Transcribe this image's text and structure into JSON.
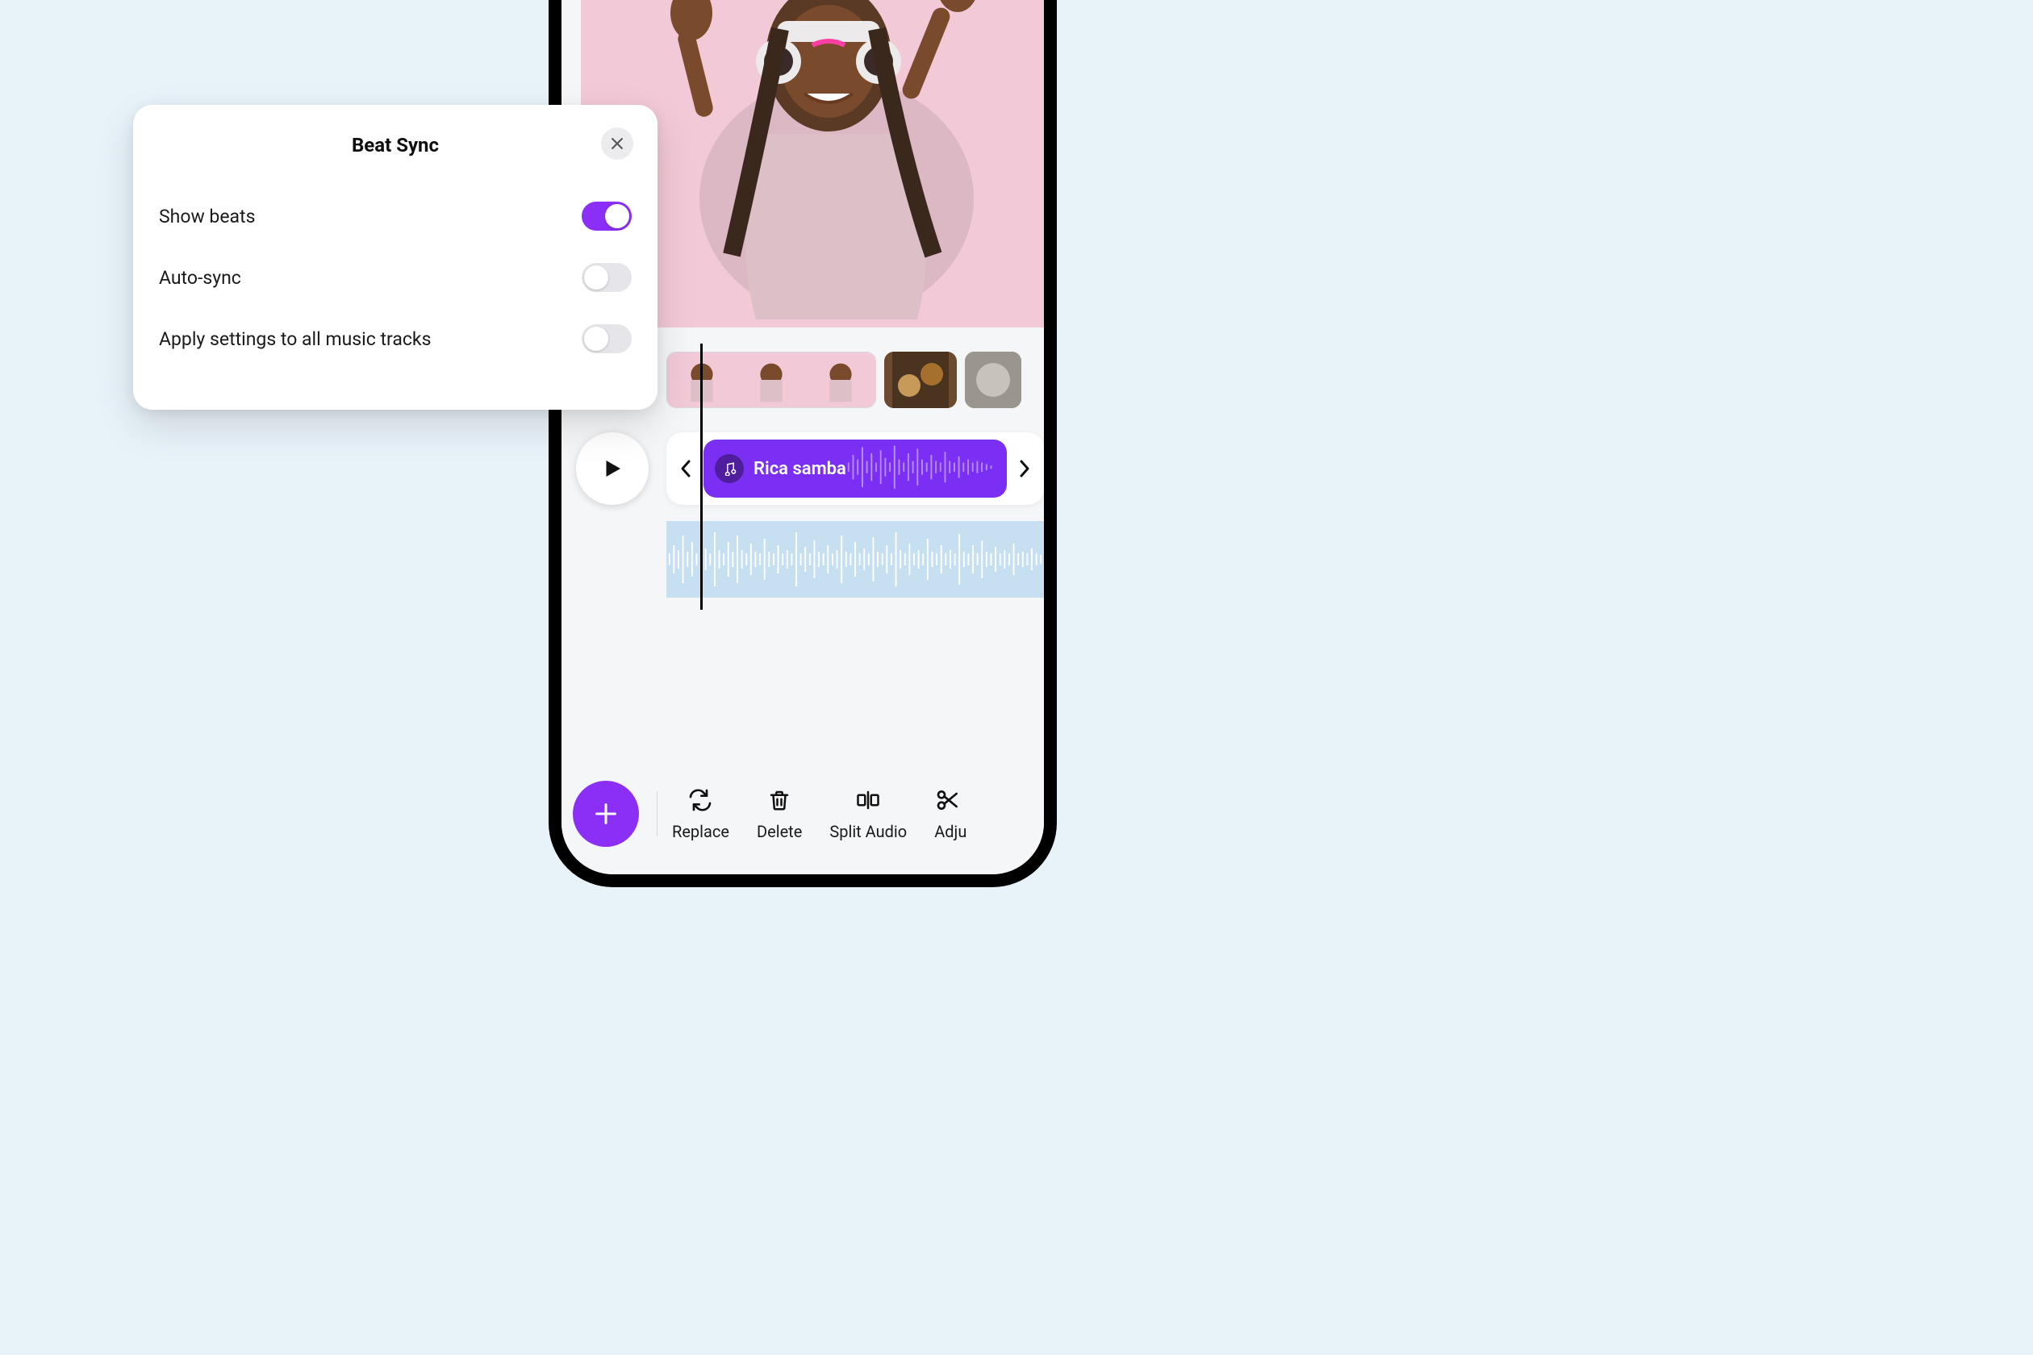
{
  "popover": {
    "title": "Beat Sync",
    "rows": [
      {
        "label": "Show beats",
        "on": true
      },
      {
        "label": "Auto-sync",
        "on": false
      },
      {
        "label": "Apply settings to all music tracks",
        "on": false
      }
    ]
  },
  "audio": {
    "track_name": "Rica samba"
  },
  "toolbar": {
    "items": [
      {
        "label": "Replace"
      },
      {
        "label": "Delete"
      },
      {
        "label": "Split Audio"
      },
      {
        "label": "Adju"
      }
    ]
  },
  "colors": {
    "accent": "#8b2ff6",
    "audio_pill": "#7a2ff2",
    "wave_bg": "#c6dff1"
  }
}
